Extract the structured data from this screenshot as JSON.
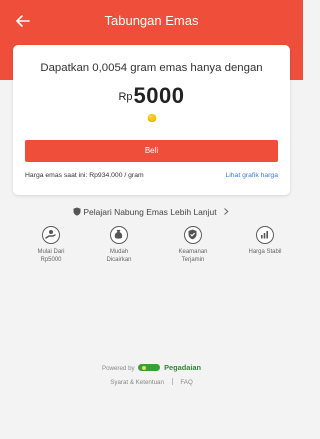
{
  "header": {
    "title": "Tabungan Emas",
    "back_icon": "arrow-left-icon",
    "color": "#ef4e3a"
  },
  "card": {
    "headline": "Dapatkan 0,0054 gram emas hanya dengan",
    "currency": "Rp",
    "amount": "5000",
    "coin_icon": "gold-coin-icon",
    "buy_label": "Beli",
    "price_text": "Harga emas saat ini: Rp934.000 / gram",
    "graph_link": "Lihat grafik harga"
  },
  "learn_more": {
    "label": "Pelajari Nabung Emas Lebih Lanjut",
    "icon": "shield-icon",
    "chevron": "chevron-right-icon"
  },
  "features": [
    {
      "icon": "hand-coin-icon",
      "line1": "Mulai Dari",
      "line2": "Rp5000"
    },
    {
      "icon": "money-bag-icon",
      "line1": "Mudah",
      "line2": "Dicairkan"
    },
    {
      "icon": "shield-check-icon",
      "line1": "Keamanan",
      "line2": "Terjamin"
    },
    {
      "icon": "bar-chart-icon",
      "line1": "Harga Stabil",
      "line2": ""
    }
  ],
  "footer": {
    "powered_by": "Powered by",
    "brand": "Pegadaian",
    "terms": "Syarat & Ketentuan",
    "faq": "FAQ",
    "brand_color": "#2d8a38"
  }
}
